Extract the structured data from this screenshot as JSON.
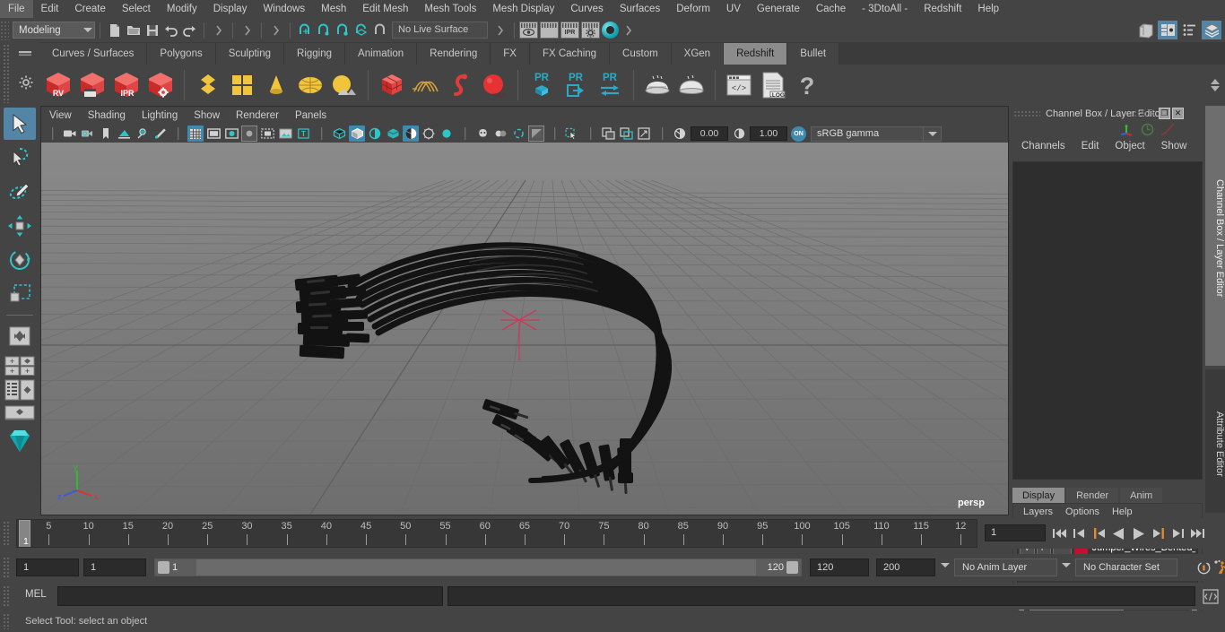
{
  "app": {
    "menu_items": [
      "File",
      "Edit",
      "Create",
      "Select",
      "Modify",
      "Display",
      "Windows",
      "Mesh",
      "Edit Mesh",
      "Mesh Tools",
      "Mesh Display",
      "Curves",
      "Surfaces",
      "Deform",
      "UV",
      "Generate",
      "Cache",
      "- 3DtoAll -",
      "Redshift",
      "Help"
    ]
  },
  "status_line": {
    "menu_set": "Modeling",
    "live_surface": "No Live Surface",
    "render_buttons": [
      "render",
      "render-sequence",
      "ipr",
      "render-settings"
    ]
  },
  "shelf": {
    "tabs": [
      "Curves / Surfaces",
      "Polygons",
      "Sculpting",
      "Rigging",
      "Animation",
      "Rendering",
      "FX",
      "FX Caching",
      "Custom",
      "XGen",
      "Redshift",
      "Bullet"
    ],
    "active_tab": "Redshift",
    "buttons": [
      {
        "name": "redshift-render-view",
        "label": "RV"
      },
      {
        "name": "redshift-render-sequence",
        "label": ""
      },
      {
        "name": "redshift-ipr",
        "label": "IPR"
      },
      {
        "name": "redshift-render-settings",
        "label": ""
      },
      {
        "name": "redshift-proxy-export",
        "label": "PR"
      },
      {
        "name": "redshift-proxy-place",
        "label": "PR"
      },
      {
        "name": "redshift-proxy-convert",
        "label": "PR"
      },
      {
        "name": "redshift-log",
        "label": ".LOG"
      },
      {
        "name": "redshift-help",
        "label": "?"
      }
    ]
  },
  "toolbox": {
    "tools": [
      "select-tool",
      "lasso-select-tool",
      "paint-select-tool",
      "move-tool",
      "rotate-tool",
      "scale-tool",
      "last-tool",
      "snap-grid",
      "snap-curve",
      "snap-point",
      "snap-view",
      "show-manipulator"
    ],
    "active_tool": "select-tool"
  },
  "viewport": {
    "menu_items": [
      "View",
      "Shading",
      "Lighting",
      "Show",
      "Renderer",
      "Panels"
    ],
    "camera_label": "persp",
    "exposure_value": "0.00",
    "gamma_value": "1.00",
    "color_space": "sRGB gamma",
    "on_badge": "ON",
    "axis_labels": {
      "x": "x",
      "y": "y",
      "z": "z"
    },
    "background_color": "#7a7a7a",
    "grid_color": "#6a6a6a",
    "object_color": "#141414",
    "origin_marker_color": "#d6335a"
  },
  "channel_box": {
    "title": "Channel Box / Layer Editor",
    "menu_items": [
      "Channels",
      "Edit",
      "Object",
      "Show"
    ],
    "restore_glyph": "❐",
    "close_glyph": "✕"
  },
  "layer_editor": {
    "tabs": [
      "Display",
      "Render",
      "Anim"
    ],
    "active_tab": "Display",
    "menu_items": [
      "Layers",
      "Options",
      "Help"
    ],
    "layers": [
      {
        "visibility": "V",
        "playback": "P",
        "shading": "",
        "color": "#c2102e",
        "name": "Jumper_Wires_Bented_"
      }
    ]
  },
  "vertical_tabs": {
    "items": [
      "Channel Box / Layer Editor",
      "Attribute Editor"
    ],
    "active": "Channel Box / Layer Editor"
  },
  "time_slider": {
    "ticks": [
      5,
      10,
      15,
      20,
      25,
      30,
      35,
      40,
      45,
      50,
      55,
      60,
      65,
      70,
      75,
      80,
      85,
      90,
      95,
      100,
      105,
      110,
      115
    ],
    "last_partial_label": "12",
    "playhead_frame": "1",
    "current_frame": "1",
    "transport": [
      "go-to-start",
      "step-back-key",
      "step-back-frame",
      "play-backwards",
      "play-forwards",
      "step-forward-frame",
      "step-forward-key",
      "go-to-end"
    ]
  },
  "range_slider": {
    "start_field": "1",
    "anim_start_field": "1",
    "range_start_label": "1",
    "range_end_label": "120",
    "anim_end_field": "120",
    "end_field": "200",
    "anim_layer": "No Anim Layer",
    "character_set": "No Character Set"
  },
  "command_line": {
    "label": "MEL",
    "input_value": "",
    "output_value": ""
  },
  "help_line": {
    "text": "Select Tool: select an object"
  },
  "colors": {
    "accent_blue": "#3f8bb0",
    "shelf_active": "#8c8c8c",
    "panel_bg": "#444444",
    "viewport_bg": "#7a7a7a",
    "layer_red": "#c2102e",
    "transport_orange": "#e08a2c"
  }
}
